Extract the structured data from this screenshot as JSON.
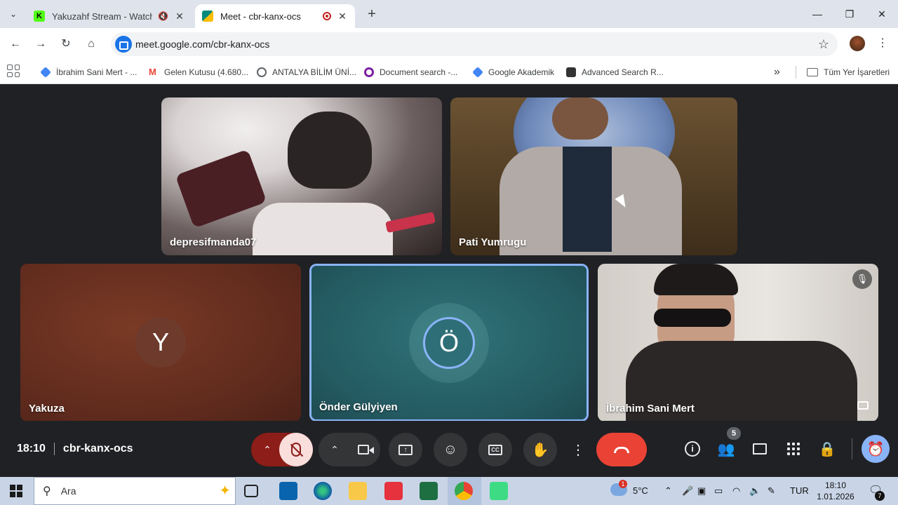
{
  "browser": {
    "tabs": [
      {
        "title": "Yakuzahf Stream - Watch Li",
        "favicon_color": "#53fc18",
        "audio_icon": "muted-speaker-icon"
      },
      {
        "title": "Meet - cbr-kanx-ocs",
        "favicon_color": "#00897b",
        "audio_icon": "recording-icon"
      }
    ],
    "new_tab_label": "+",
    "url": "meet.google.com/cbr-kanx-ocs",
    "bookmarks": [
      {
        "label": "İbrahim Sani Mert - ...",
        "icon_color": "#4285f4"
      },
      {
        "label": "Gelen Kutusu (4.680...",
        "icon_color": "#ea4335"
      },
      {
        "label": "ANTALYA BİLİM ÜNİ...",
        "icon_color": "#5f6368"
      },
      {
        "label": "Document search -...",
        "icon_color": "#7b1fa2"
      },
      {
        "label": "Google Akademik",
        "icon_color": "#4285f4"
      },
      {
        "label": "Advanced Search R...",
        "icon_color": "#333333"
      }
    ],
    "bookmarks_overflow": "»",
    "all_bookmarks_label": "Tüm Yer İşaretleri"
  },
  "meet": {
    "participants": [
      {
        "name": "depresifmanda07"
      },
      {
        "name": "Pati Yumrugu"
      },
      {
        "name": "Yakuza",
        "avatar_letter": "Y",
        "bg_color": "#6b2f1f"
      },
      {
        "name": "Önder Gülyiyen",
        "avatar_letter": "Ö",
        "bg_color": "#2b6b73",
        "speaking": true
      },
      {
        "name": "İbrahim Sani Mert",
        "muted": true
      }
    ],
    "clock": "18:10",
    "meeting_code": "cbr-kanx-ocs",
    "people_count": "5",
    "accent_color": "#8ab4f8",
    "end_call_color": "#ea4335"
  },
  "taskbar": {
    "search_placeholder": "Ara",
    "weather": "5°C",
    "language": "TUR",
    "time": "18:10",
    "date": "1.01.2026",
    "notification_count": "7",
    "weather_badge": "1"
  }
}
